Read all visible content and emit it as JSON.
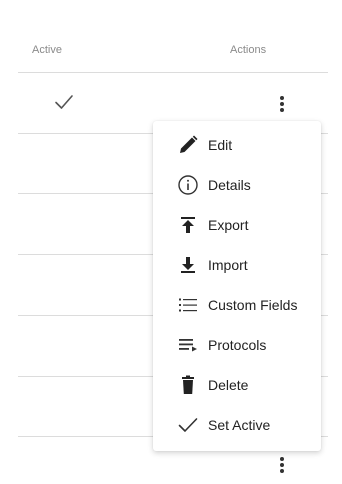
{
  "table": {
    "headers": {
      "active": "Active",
      "actions": "Actions"
    }
  },
  "menu": {
    "items": [
      {
        "label": "Edit",
        "icon": "pencil-icon"
      },
      {
        "label": "Details",
        "icon": "info-icon"
      },
      {
        "label": "Export",
        "icon": "export-icon"
      },
      {
        "label": "Import",
        "icon": "import-icon"
      },
      {
        "label": "Custom Fields",
        "icon": "list-icon"
      },
      {
        "label": "Protocols",
        "icon": "playlist-play-icon"
      },
      {
        "label": "Delete",
        "icon": "trash-icon"
      },
      {
        "label": "Set Active",
        "icon": "check-icon"
      }
    ]
  }
}
